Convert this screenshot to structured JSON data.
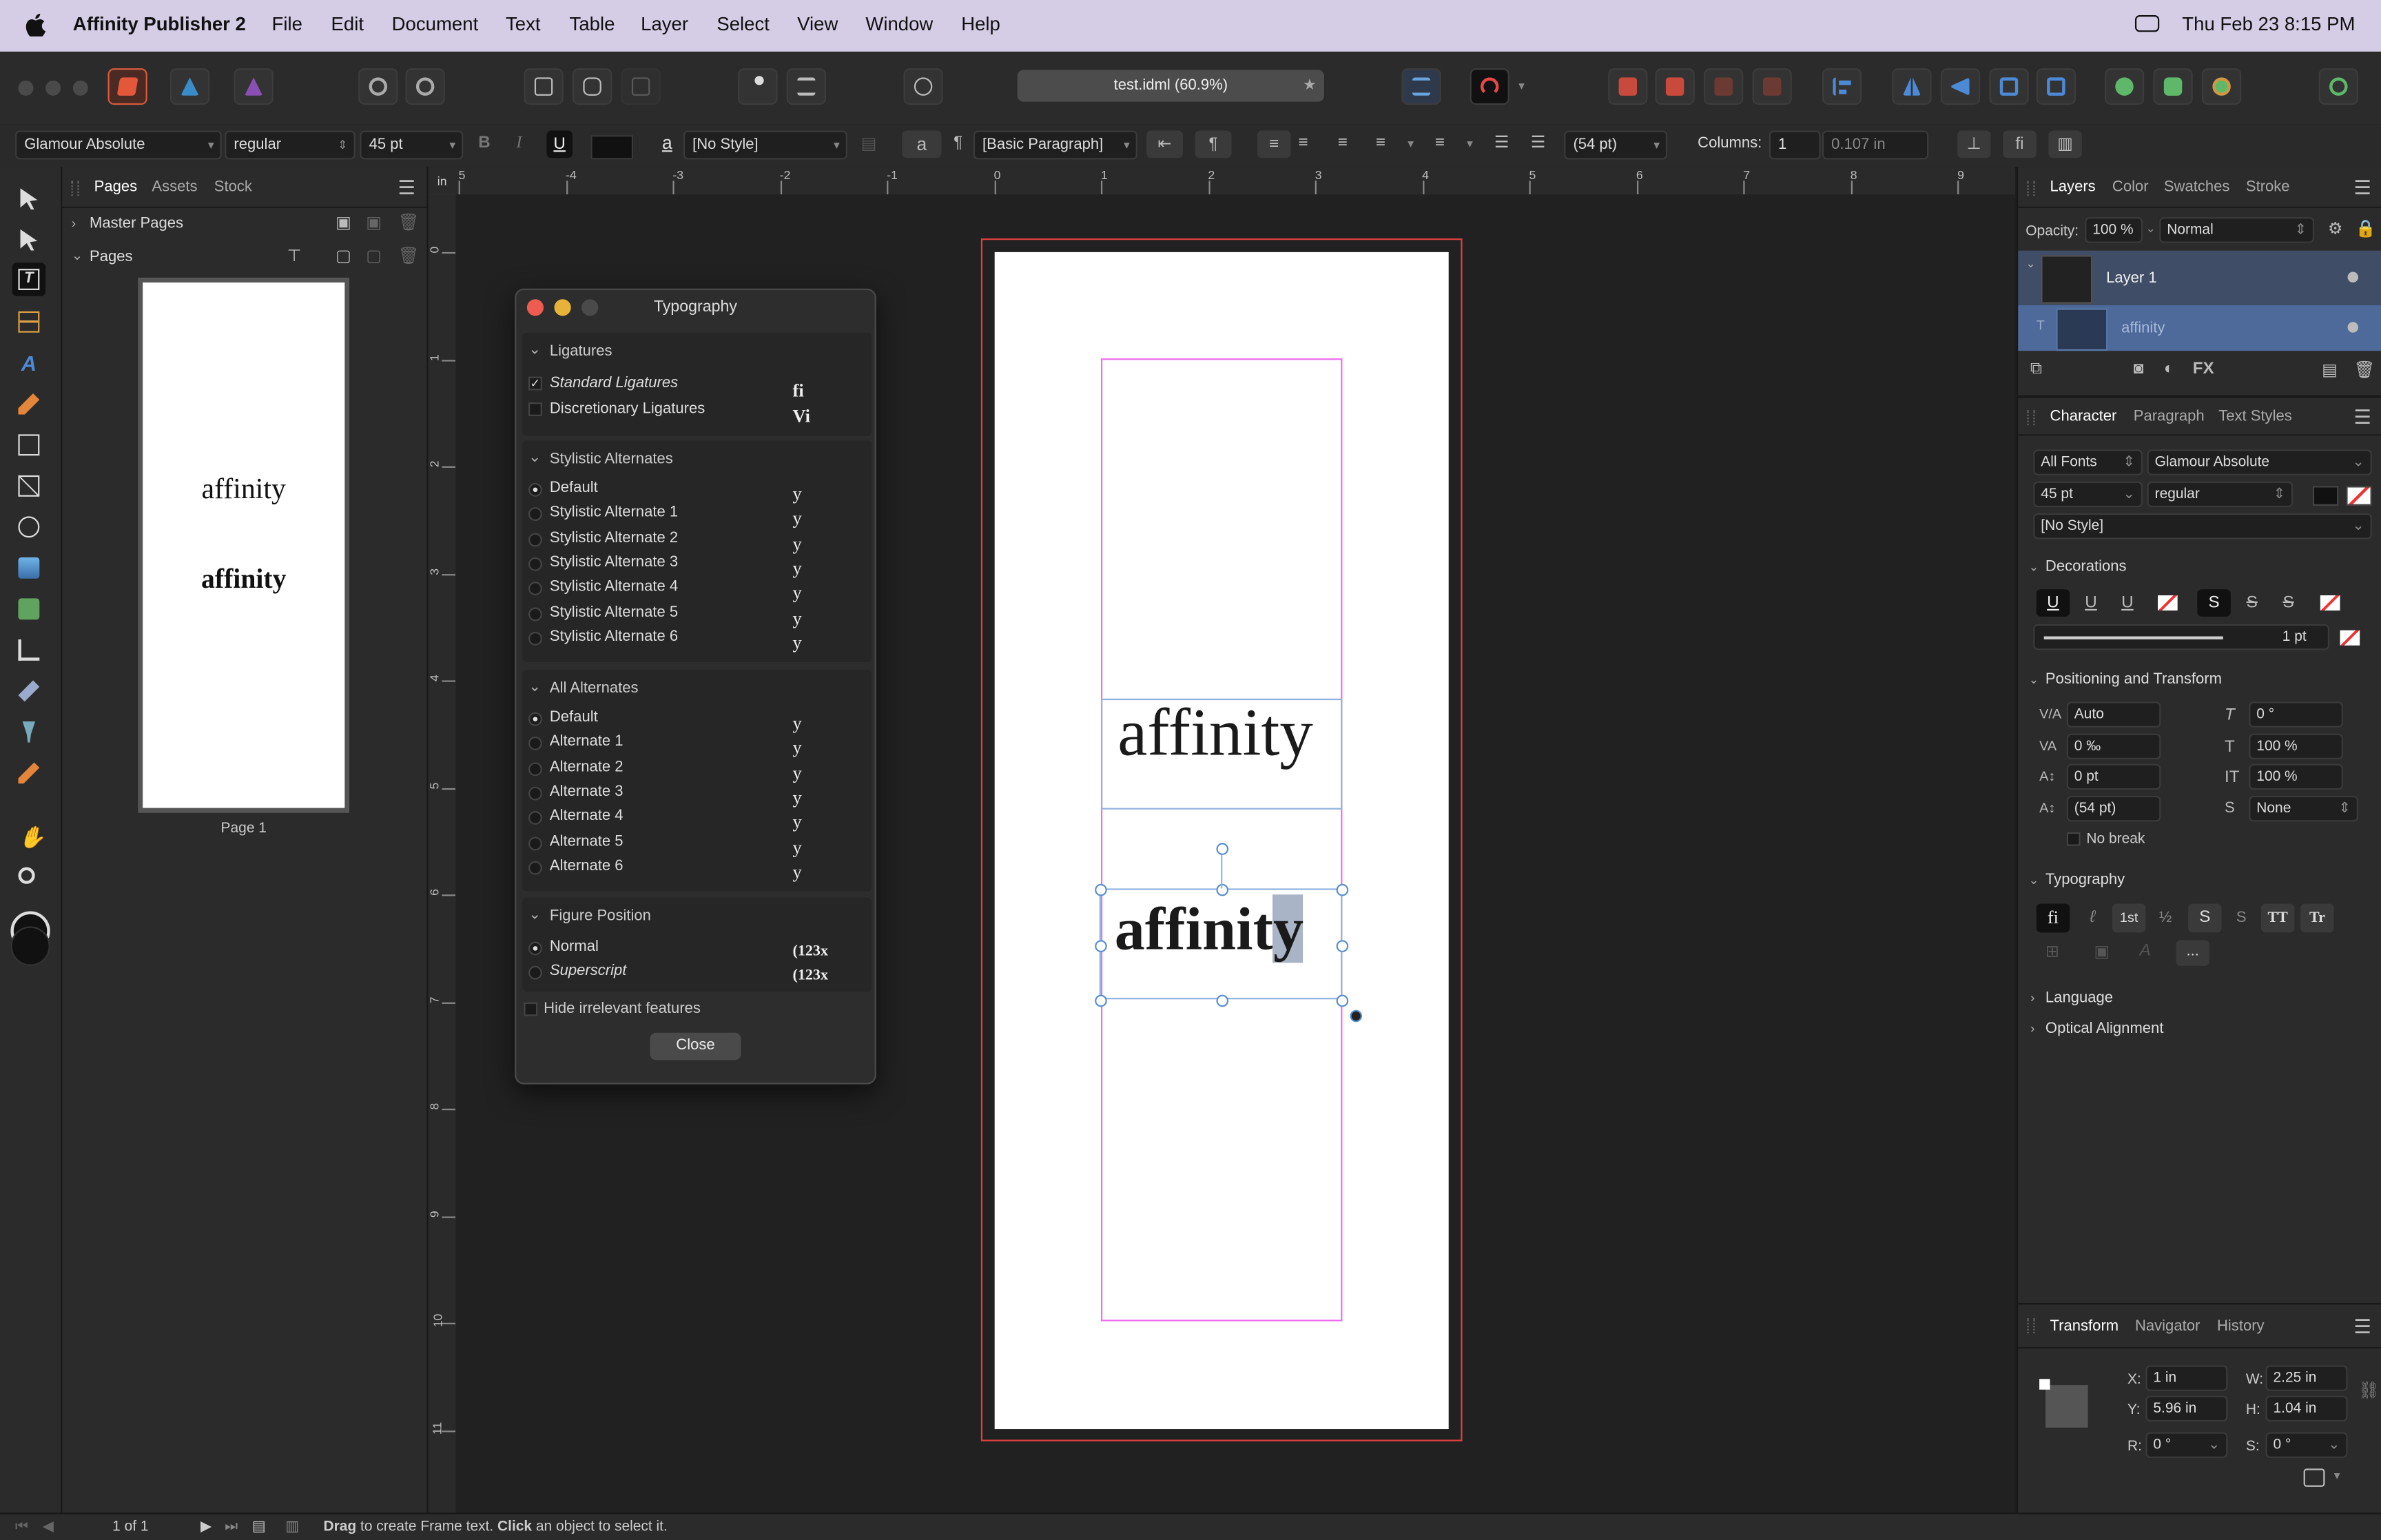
{
  "menubar": {
    "app_name": "Affinity Publisher 2",
    "items": [
      "File",
      "Edit",
      "Document",
      "Text",
      "Table",
      "Layer",
      "Select",
      "View",
      "Window",
      "Help"
    ],
    "datetime": "Thu Feb 23  8:15 PM"
  },
  "toolbar": {
    "document_tab": "test.idml (60.9%)",
    "accent": "#d95a3c"
  },
  "context": {
    "font": "Glamour Absolute",
    "weight": "regular",
    "size": "45 pt",
    "bold": "B",
    "italic": "I",
    "underline": "U",
    "char_style_icon": "a",
    "char_style": "[No Style]",
    "char_icon2": "a",
    "para_icon": "¶",
    "para_style": "[Basic Paragraph]",
    "para_btn": "¶",
    "leading": "(54 pt)",
    "columns_label": "Columns:",
    "columns": "1",
    "gutter": "0.107 in",
    "fi_btn": "fi"
  },
  "ruler": {
    "unit": "in",
    "h_ticks": [
      "5",
      "-4",
      "-3",
      "-2",
      "-1",
      "0",
      "1",
      "2",
      "3",
      "4",
      "5",
      "6",
      "7",
      "8",
      "9"
    ],
    "v_ticks": [
      "0",
      "1",
      "2",
      "3",
      "4",
      "5",
      "6",
      "7",
      "8",
      "9",
      "10",
      "11"
    ]
  },
  "pages_panel": {
    "tabs": [
      "Pages",
      "Assets",
      "Stock"
    ],
    "master_pages": "Master Pages",
    "pages": "Pages",
    "thumb_text1": "affinity",
    "thumb_text2": "affinity",
    "page_label": "Page 1"
  },
  "typography_dialog": {
    "title": "Typography",
    "ligatures": {
      "header": "Ligatures",
      "items": [
        {
          "label": "Standard Ligatures",
          "glyph": "fi",
          "checked": true
        },
        {
          "label": "Discretionary Ligatures",
          "glyph": "Vi",
          "checked": false
        }
      ]
    },
    "stylistic": {
      "header": "Stylistic Alternates",
      "items": [
        {
          "label": "Default",
          "glyph": "y"
        },
        {
          "label": "Stylistic Alternate 1",
          "glyph": "y"
        },
        {
          "label": "Stylistic Alternate 2",
          "glyph": "y"
        },
        {
          "label": "Stylistic Alternate 3",
          "glyph": "y"
        },
        {
          "label": "Stylistic Alternate 4",
          "glyph": "y"
        },
        {
          "label": "Stylistic Alternate 5",
          "glyph": "y"
        },
        {
          "label": "Stylistic Alternate 6",
          "glyph": "y"
        }
      ]
    },
    "all_alternates": {
      "header": "All Alternates",
      "items": [
        {
          "label": "Default",
          "glyph": "y"
        },
        {
          "label": "Alternate 1",
          "glyph": "y"
        },
        {
          "label": "Alternate 2",
          "glyph": "y"
        },
        {
          "label": "Alternate 3",
          "glyph": "y"
        },
        {
          "label": "Alternate 4",
          "glyph": "y"
        },
        {
          "label": "Alternate 5",
          "glyph": "y"
        },
        {
          "label": "Alternate 6",
          "glyph": "y"
        }
      ]
    },
    "figure_position": {
      "header": "Figure Position",
      "items": [
        {
          "label": "Normal",
          "glyph": "(123x"
        },
        {
          "label": "Superscript",
          "glyph": "(123x"
        }
      ]
    },
    "hide_label": "Hide irrelevant features",
    "close_label": "Close"
  },
  "canvas": {
    "text1": "affinity",
    "text2_main": "affinit",
    "text2_sel": "y"
  },
  "layers_panel": {
    "tabs": [
      "Layers",
      "Color",
      "Swatches",
      "Stroke"
    ],
    "opacity_label": "Opacity:",
    "opacity": "100 %",
    "blend": "Normal",
    "layer1": "Layer 1",
    "layer2": "affinity"
  },
  "character_panel": {
    "tabs": [
      "Character",
      "Paragraph",
      "Text Styles"
    ],
    "collection": "All Fonts",
    "font": "Glamour Absolute",
    "size": "45 pt",
    "weight": "regular",
    "style": "[No Style]",
    "decorations": "Decorations",
    "deco_buttons": [
      "U",
      "U",
      "U",
      "S",
      "S",
      "S"
    ],
    "stroke_weight": "1 pt",
    "positioning": "Positioning and Transform",
    "kerning": "Auto",
    "tracking": "0 ‰",
    "baseline": "0 pt",
    "leading": "(54 pt)",
    "shear": "0 °",
    "hscale": "100 %",
    "vscale": "100 %",
    "superscript_mode": "None",
    "no_break": "No break",
    "typography": "Typography",
    "typo_buttons": [
      "fi",
      "ℓ",
      "1st",
      "½",
      "S",
      "S",
      "TT",
      "Tr"
    ],
    "more": "...",
    "language": "Language",
    "optical": "Optical Alignment"
  },
  "transform_panel": {
    "tabs": [
      "Transform",
      "Navigator",
      "History"
    ],
    "x_label": "X:",
    "x": "1 in",
    "y_label": "Y:",
    "y": "5.96 in",
    "w_label": "W:",
    "w": "2.25 in",
    "h_label": "H:",
    "h": "1.04 in",
    "r_label": "R:",
    "r": "0 °",
    "s_label": "S:",
    "s": "0 °"
  },
  "statusbar": {
    "page": "1 of 1",
    "drag": "Drag",
    "msg1": " to create Frame text. ",
    "click": "Click",
    "msg2": " an object to select it."
  }
}
